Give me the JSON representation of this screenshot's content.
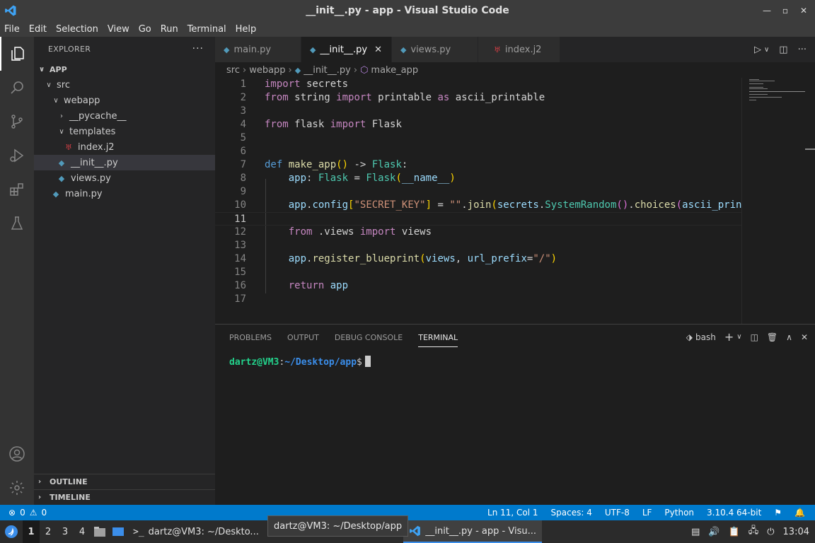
{
  "window": {
    "title": "__init__.py - app - Visual Studio Code"
  },
  "menu": [
    "File",
    "Edit",
    "Selection",
    "View",
    "Go",
    "Run",
    "Terminal",
    "Help"
  ],
  "sidebar": {
    "header": "EXPLORER",
    "root": "APP",
    "tree": [
      {
        "label": "src",
        "type": "folder-open"
      },
      {
        "label": "webapp",
        "type": "folder-open"
      },
      {
        "label": "__pycache__",
        "type": "folder-closed"
      },
      {
        "label": "templates",
        "type": "folder-open"
      },
      {
        "label": "index.j2",
        "type": "j2"
      },
      {
        "label": "__init__.py",
        "type": "py"
      },
      {
        "label": "views.py",
        "type": "py"
      },
      {
        "label": "main.py",
        "type": "py"
      }
    ],
    "outline": "OUTLINE",
    "timeline": "TIMELINE"
  },
  "tabs": [
    {
      "label": "main.py",
      "icon": "python-icon"
    },
    {
      "label": "__init__.py",
      "icon": "python-icon"
    },
    {
      "label": "views.py",
      "icon": "python-icon"
    },
    {
      "label": "index.j2",
      "icon": "jinja-icon"
    }
  ],
  "breadcrumb": [
    "src",
    "webapp",
    "__init__.py",
    "make_app"
  ],
  "editor": {
    "line_numbers": [
      "1",
      "2",
      "3",
      "4",
      "5",
      "6",
      "7",
      "8",
      "9",
      "10",
      "11",
      "12",
      "13",
      "14",
      "15",
      "16",
      "17"
    ]
  },
  "panel": {
    "tabs": [
      "PROBLEMS",
      "OUTPUT",
      "DEBUG CONSOLE",
      "TERMINAL"
    ],
    "shell": "bash",
    "prompt_user": "dartz@VM3",
    "prompt_sep": ":",
    "prompt_path": "~/Desktop/app",
    "prompt_end": "$"
  },
  "status": {
    "errors": "0",
    "warnings": "0",
    "position": "Ln 11, Col 1",
    "spaces": "Spaces: 4",
    "encoding": "UTF-8",
    "eol": "LF",
    "language": "Python",
    "interpreter": "3.10.4 64-bit"
  },
  "taskbar": {
    "workspaces": [
      "1",
      "2",
      "3",
      "4"
    ],
    "terminal_task": "dartz@VM3: ~/Deskto...",
    "vscode_task": "__init__.py - app - Visu...",
    "tooltip": "dartz@VM3: ~/Desktop/app",
    "clock": "13:04"
  }
}
